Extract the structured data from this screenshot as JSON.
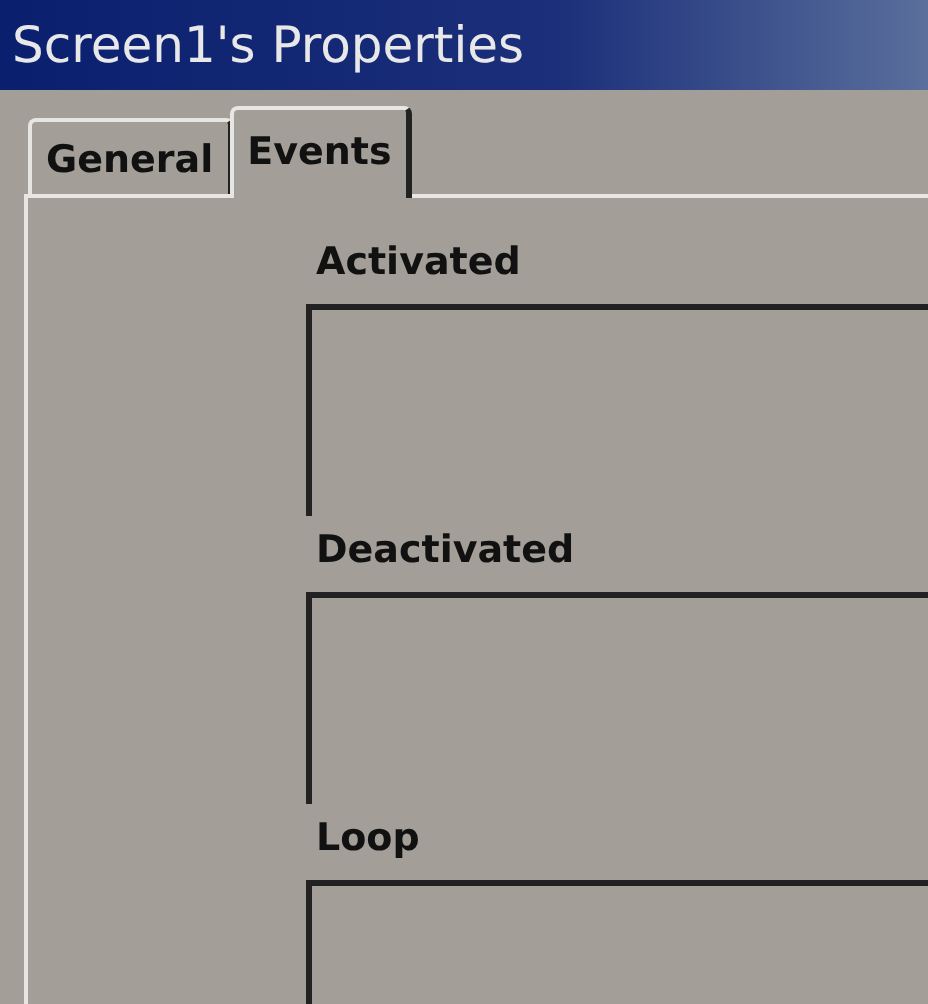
{
  "window": {
    "title": "Screen1's Properties"
  },
  "tabs": [
    {
      "label": "General",
      "selected": false
    },
    {
      "label": "Events",
      "selected": true
    }
  ],
  "events": [
    {
      "label": "Activated"
    },
    {
      "label": "Deactivated"
    },
    {
      "label": "Loop"
    }
  ]
}
